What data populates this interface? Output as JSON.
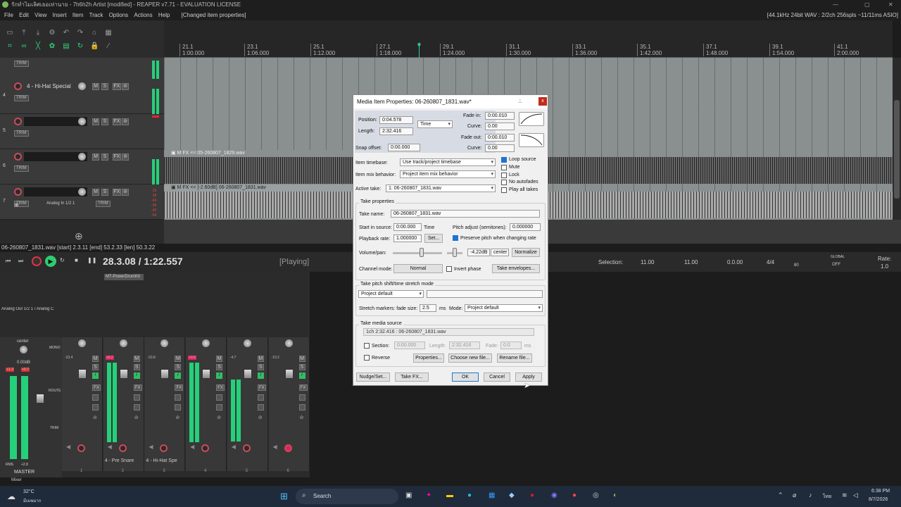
{
  "window": {
    "title": "รักทำไมเลิศเธอเท่านาย - 7h6h2h Artist [modified] - REAPER v7.71 - EVALUATION LICENSE",
    "status_right": "[44.1kHz 24bit WAV : 2/2ch 256spls ~11/11ms ASIO]"
  },
  "menu": [
    "File",
    "Edit",
    "View",
    "Insert",
    "Item",
    "Track",
    "Options",
    "Actions",
    "Help",
    "[Changed item properties]"
  ],
  "ruler": {
    "marks": [
      {
        "bar": "21.1",
        "time": "1:00.000"
      },
      {
        "bar": "23.1",
        "time": "1:06.000"
      },
      {
        "bar": "25.1",
        "time": "1:12.000"
      },
      {
        "bar": "27.1",
        "time": "1:18.000"
      },
      {
        "bar": "29.1",
        "time": "1:24.000"
      },
      {
        "bar": "31.1",
        "time": "1:30.000"
      },
      {
        "bar": "33.1",
        "time": "1:36.000"
      },
      {
        "bar": "35.1",
        "time": "1:42.000"
      },
      {
        "bar": "37.1",
        "time": "1:48.000"
      },
      {
        "bar": "39.1",
        "time": "1:54.000"
      },
      {
        "bar": "41.1",
        "time": "2:00.000"
      }
    ]
  },
  "tracks": [
    {
      "num": "4",
      "name": "4 - Hi-Hat Special",
      "trim": "TRIM"
    },
    {
      "num": "5",
      "name": "",
      "trim": "TRIM"
    },
    {
      "num": "6",
      "name": "",
      "trim": "TRIM"
    },
    {
      "num": "7",
      "name": "",
      "trim": "TRIM",
      "input": "Analog In 1/2 1"
    }
  ],
  "track_buttons": {
    "mute": "M",
    "solo": "S",
    "fx": "FX"
  },
  "items": {
    "item1": "<< 05-260807_1829.wav",
    "item2": "<< [-2.60dB] 06-260807_1831.wav"
  },
  "meter_values": [
    "-15",
    "-18",
    "-24",
    "-36",
    "-42",
    "-54"
  ],
  "status_line": "06-260807_1831.wav [start] 2.3.11 [end] 53.2.33 [len] 50.3.22",
  "transport": {
    "position": "28.3.08 / 1:22.557",
    "state": "[Playing]",
    "selection_label": "Selection:",
    "sel_start": "11.00",
    "sel_end": "11.00",
    "sel_len": "0.0.00",
    "time_sig": "4/4",
    "bpm": "80",
    "global": "GLOBAL",
    "global_state": "OFF",
    "rate_label": "Rate:",
    "rate": "1.0"
  },
  "mixer": {
    "plugin": "MT-PowerDrumKit",
    "output": "Analog Out 1/2 1 / Analog C",
    "master_label": "MASTER",
    "pan": "center",
    "vol": "0.00dB",
    "master_peaks": [
      "+1.3",
      "+0.7"
    ],
    "mono": "MONO",
    "route": "ROUTE",
    "trim": "TRIM",
    "rms": "RMS",
    "rms_val": "+2.8",
    "mixer_label": "Mixer",
    "strips": [
      {
        "num": "1",
        "name": "",
        "peak": "-33.4",
        "hot": false
      },
      {
        "num": "2",
        "name": "4 - Pre Snare",
        "peak": "+0.2",
        "hot": true
      },
      {
        "num": "3",
        "name": "4 - Hi-Hat Spe",
        "peak": "-33.8",
        "hot": false
      },
      {
        "num": "4",
        "name": "",
        "peak": "+0.6",
        "hot": true
      },
      {
        "num": "5",
        "name": "",
        "peak": "-4.7",
        "hot": false
      },
      {
        "num": "6",
        "name": "",
        "peak": "-10.2",
        "hot": false
      }
    ]
  },
  "dialog": {
    "title": "Media Item Properties: 06-260807_1831.wav*",
    "position_label": "Position:",
    "position": "0:04.578",
    "length_label": "Length:",
    "length": "2:32.416",
    "time_mode": "Time",
    "fadein_label": "Fade in:",
    "fadein": "0:00.010",
    "curve_label": "Curve:",
    "fadein_curve": "0.00",
    "fadeout_label": "Fade out:",
    "fadeout": "0:00.010",
    "fadeout_curve": "0.00",
    "snap_label": "Snap offset:",
    "snap": "0:00.000",
    "timebase_label": "Item timebase:",
    "timebase": "Use track/project timebase",
    "mix_label": "Item mix behavior:",
    "mix": "Project item mix behavior",
    "active_take_label": "Active take:",
    "active_take": "1: 06-260807_1831.wav",
    "checks": [
      {
        "label": "Loop source",
        "on": true
      },
      {
        "label": "Mute",
        "on": false
      },
      {
        "label": "Lock",
        "on": false
      },
      {
        "label": "No autofades",
        "on": false
      },
      {
        "label": "Play all takes",
        "on": false
      }
    ],
    "take_props": "Take properties",
    "take_name_label": "Take name:",
    "take_name": "06-260807_1831.wav",
    "start_src_label": "Start in source:",
    "start_src": "0:00.000",
    "time_word": "Time",
    "pitch_label": "Pitch adjust (semitones):",
    "pitch": "0.000000",
    "rate_label": "Playback rate:",
    "rate": "1.000000",
    "set_btn": "Set...",
    "preserve_pitch": "Preserve pitch when changing rate",
    "volpan_label": "Volume/pan:",
    "vol_db": "-4.22dB",
    "pan": "center",
    "normalize": "Normalize",
    "chmode_label": "Channel mode:",
    "chmode": "Normal",
    "invert_phase": "Invert phase",
    "take_env": "Take envelopes...",
    "pitchshift_title": "Take pitch shift/time stretch mode",
    "pitchshift": "Project default",
    "stretch_label": "Stretch markers: fade size:",
    "stretch_size": "2.5",
    "ms": "ms",
    "mode_label": "Mode:",
    "mode": "Project default",
    "media_src_title": "Take media source",
    "media_src": "1ch 2:32.416 : 06-260807_1831.wav",
    "section_label": "Section:",
    "section": "0:00.000",
    "sect_len_label": "Length:",
    "sect_len": "2:32.416",
    "fade_label": "Fade:",
    "fade": "0.0",
    "reverse": "Reverse",
    "properties_btn": "Properties...",
    "choose_btn": "Choose new file...",
    "rename_btn": "Rename file...",
    "nudge_btn": "Nudge/Set...",
    "takefx_btn": "Take FX...",
    "ok_btn": "OK",
    "cancel_btn": "Cancel",
    "apply_btn": "Apply"
  },
  "taskbar": {
    "temp": "32°C",
    "weather": "มีเมฆมาก",
    "search": "Search",
    "lang": "ไทย",
    "time": "6:38 PM",
    "date": "8/7/2026"
  }
}
